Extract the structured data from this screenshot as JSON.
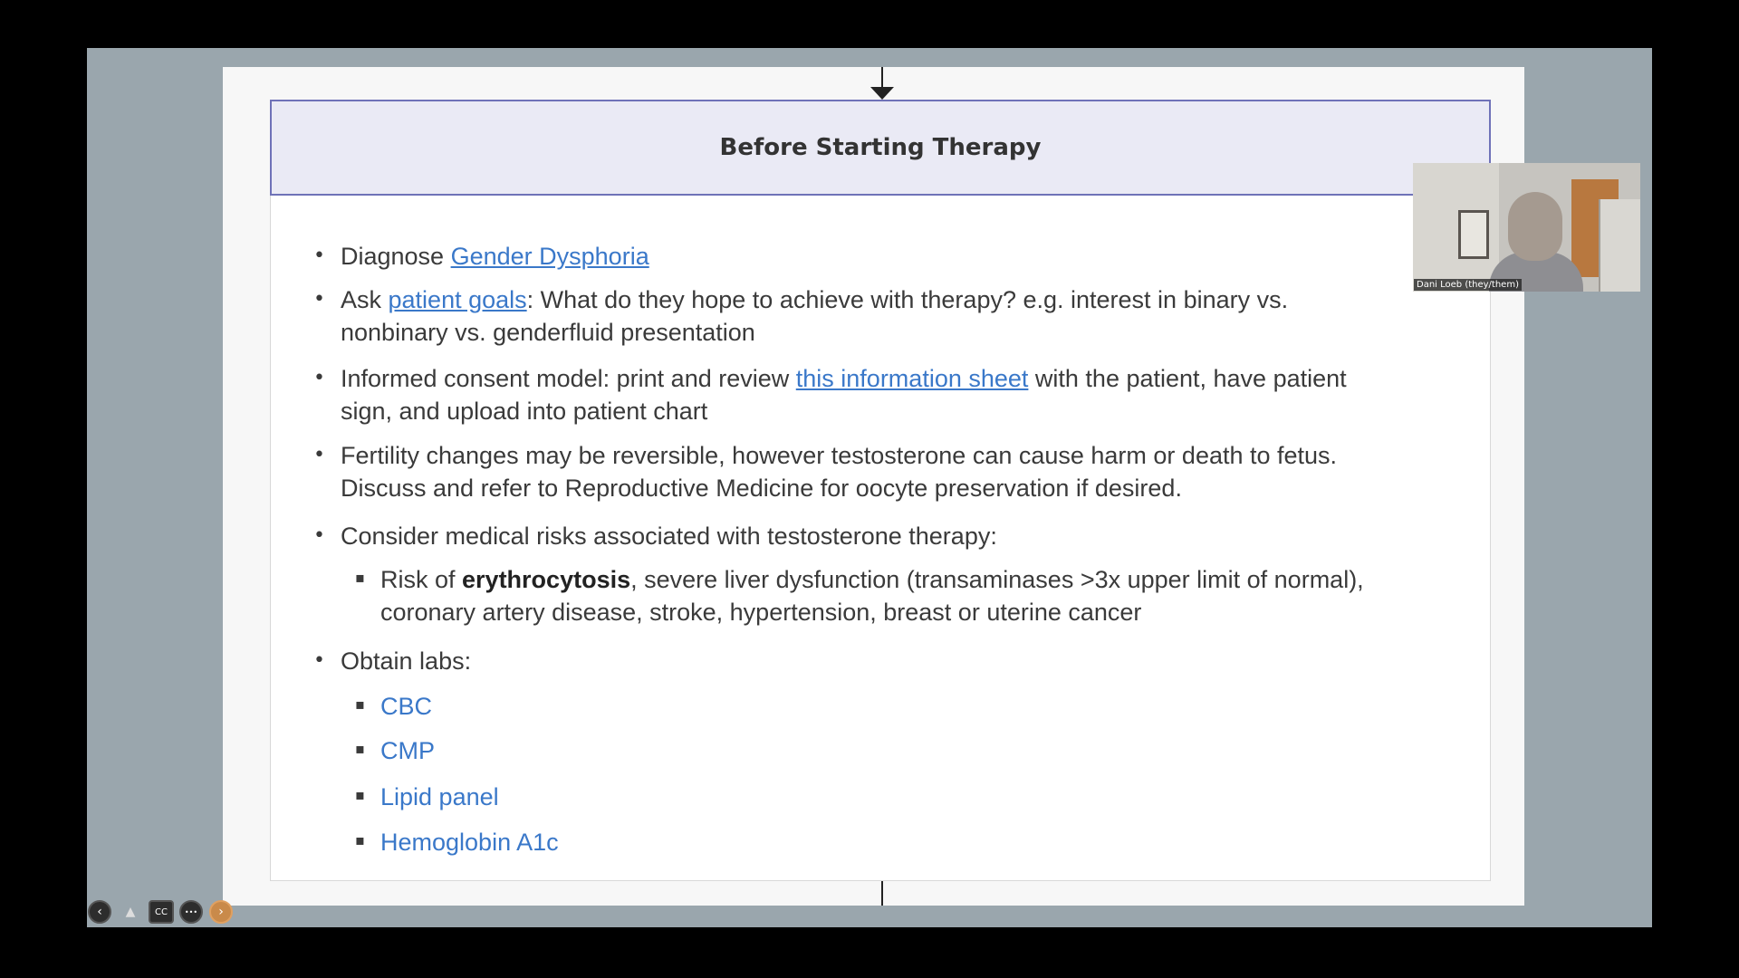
{
  "slide": {
    "title": "Before Starting Therapy",
    "items": [
      {
        "before": "Diagnose ",
        "link": "Gender Dysphoria",
        "after": ""
      },
      {
        "before": "Ask ",
        "link": "patient goals",
        "after": ": What do they hope to achieve with therapy? e.g. interest in binary vs.",
        "line2": "nonbinary vs. genderfluid presentation"
      },
      {
        "before": "Informed consent model: print and review ",
        "link": "this information sheet",
        "after": " with the patient, have patient",
        "line2": "sign, and upload into patient chart"
      },
      {
        "line1": "Fertility changes may be reversible, however testosterone can cause harm or death to fetus.",
        "line2": "Discuss and refer to Reproductive Medicine for oocyte preservation if desired."
      },
      {
        "line1": "Consider medical risks associated with testosterone therapy:"
      },
      {
        "line1": "Obtain labs:"
      }
    ],
    "risk": {
      "before": "Risk of ",
      "bold": "erythrocytosis",
      "after": ", severe liver dysfunction (transaminases >3x upper limit of normal),",
      "line2": "coronary artery disease, stroke, hypertension, breast or uterine cancer"
    },
    "labs": [
      "CBC",
      "CMP",
      "Lipid panel",
      "Hemoglobin A1c"
    ],
    "bullet_main": "•",
    "bullet_sub": "▪"
  },
  "video": {
    "participant_name": "Dani Loeb (they/them)"
  },
  "controls": {
    "back": "‹",
    "person": "▲",
    "cc": "CC",
    "more": "•••",
    "forward": "›"
  },
  "colors": {
    "link": "#3a78c9",
    "header_bg": "#eaeaf5",
    "header_border": "#6f72b8",
    "stage_bg": "#9aa6ad"
  }
}
